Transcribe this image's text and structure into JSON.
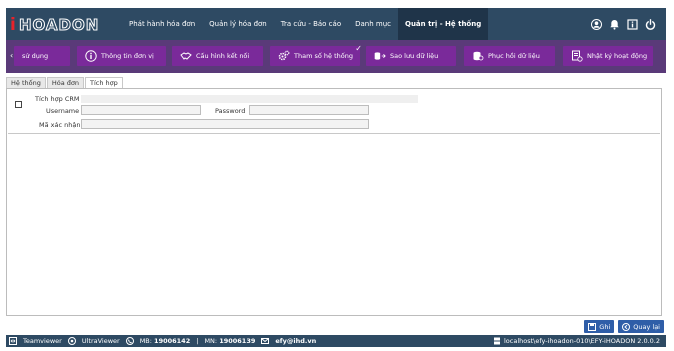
{
  "app": {
    "logo_text": "iHOADON"
  },
  "nav": {
    "items": [
      {
        "label": "Phát hành hóa đơn"
      },
      {
        "label": "Quản lý hóa đơn"
      },
      {
        "label": "Tra cứu - Báo cáo"
      },
      {
        "label": "Danh mục"
      },
      {
        "label": "Quản trị - Hệ thống"
      }
    ],
    "active_index": 4
  },
  "subnav": {
    "items": [
      {
        "label": "sử dụng"
      },
      {
        "label": "Thông tin đơn vị"
      },
      {
        "label": "Cấu hình kết nối"
      },
      {
        "label": "Tham số hệ thống"
      },
      {
        "label": "Sao lưu dữ liệu"
      },
      {
        "label": "Phục hồi dữ liệu"
      },
      {
        "label": "Nhật ký hoạt động"
      }
    ],
    "colors": {
      "bar": "#5a3a79",
      "button": "#7a2a9a"
    }
  },
  "tabs": [
    {
      "label": "Hệ thống"
    },
    {
      "label": "Hóa đơn"
    },
    {
      "label": "Tích hợp"
    }
  ],
  "active_tab": 2,
  "form": {
    "section_label": "Tích hợp CRM",
    "checked": false,
    "username_label": "Username",
    "username_value": "",
    "password_label": "Password",
    "password_value": "",
    "code_label": "Mã xác nhận",
    "code_value": ""
  },
  "actions": {
    "save_label": "Ghi",
    "back_label": "Quay lại"
  },
  "status": {
    "teamviewer": "Teamviewer",
    "ultraviewer": "UltraViewer",
    "mb_label": "MB:",
    "mb_phone": "19006142",
    "separator": "|",
    "mn_label": "MN:",
    "mn_phone": "19006139",
    "email": "efy@ihd.vn",
    "server": "localhost\\efy-ihoadon-010\\EFY-iHOADON 2.0.0.2"
  },
  "theme": {
    "header": "#2e4a63",
    "accent": "#2f5ea8"
  }
}
